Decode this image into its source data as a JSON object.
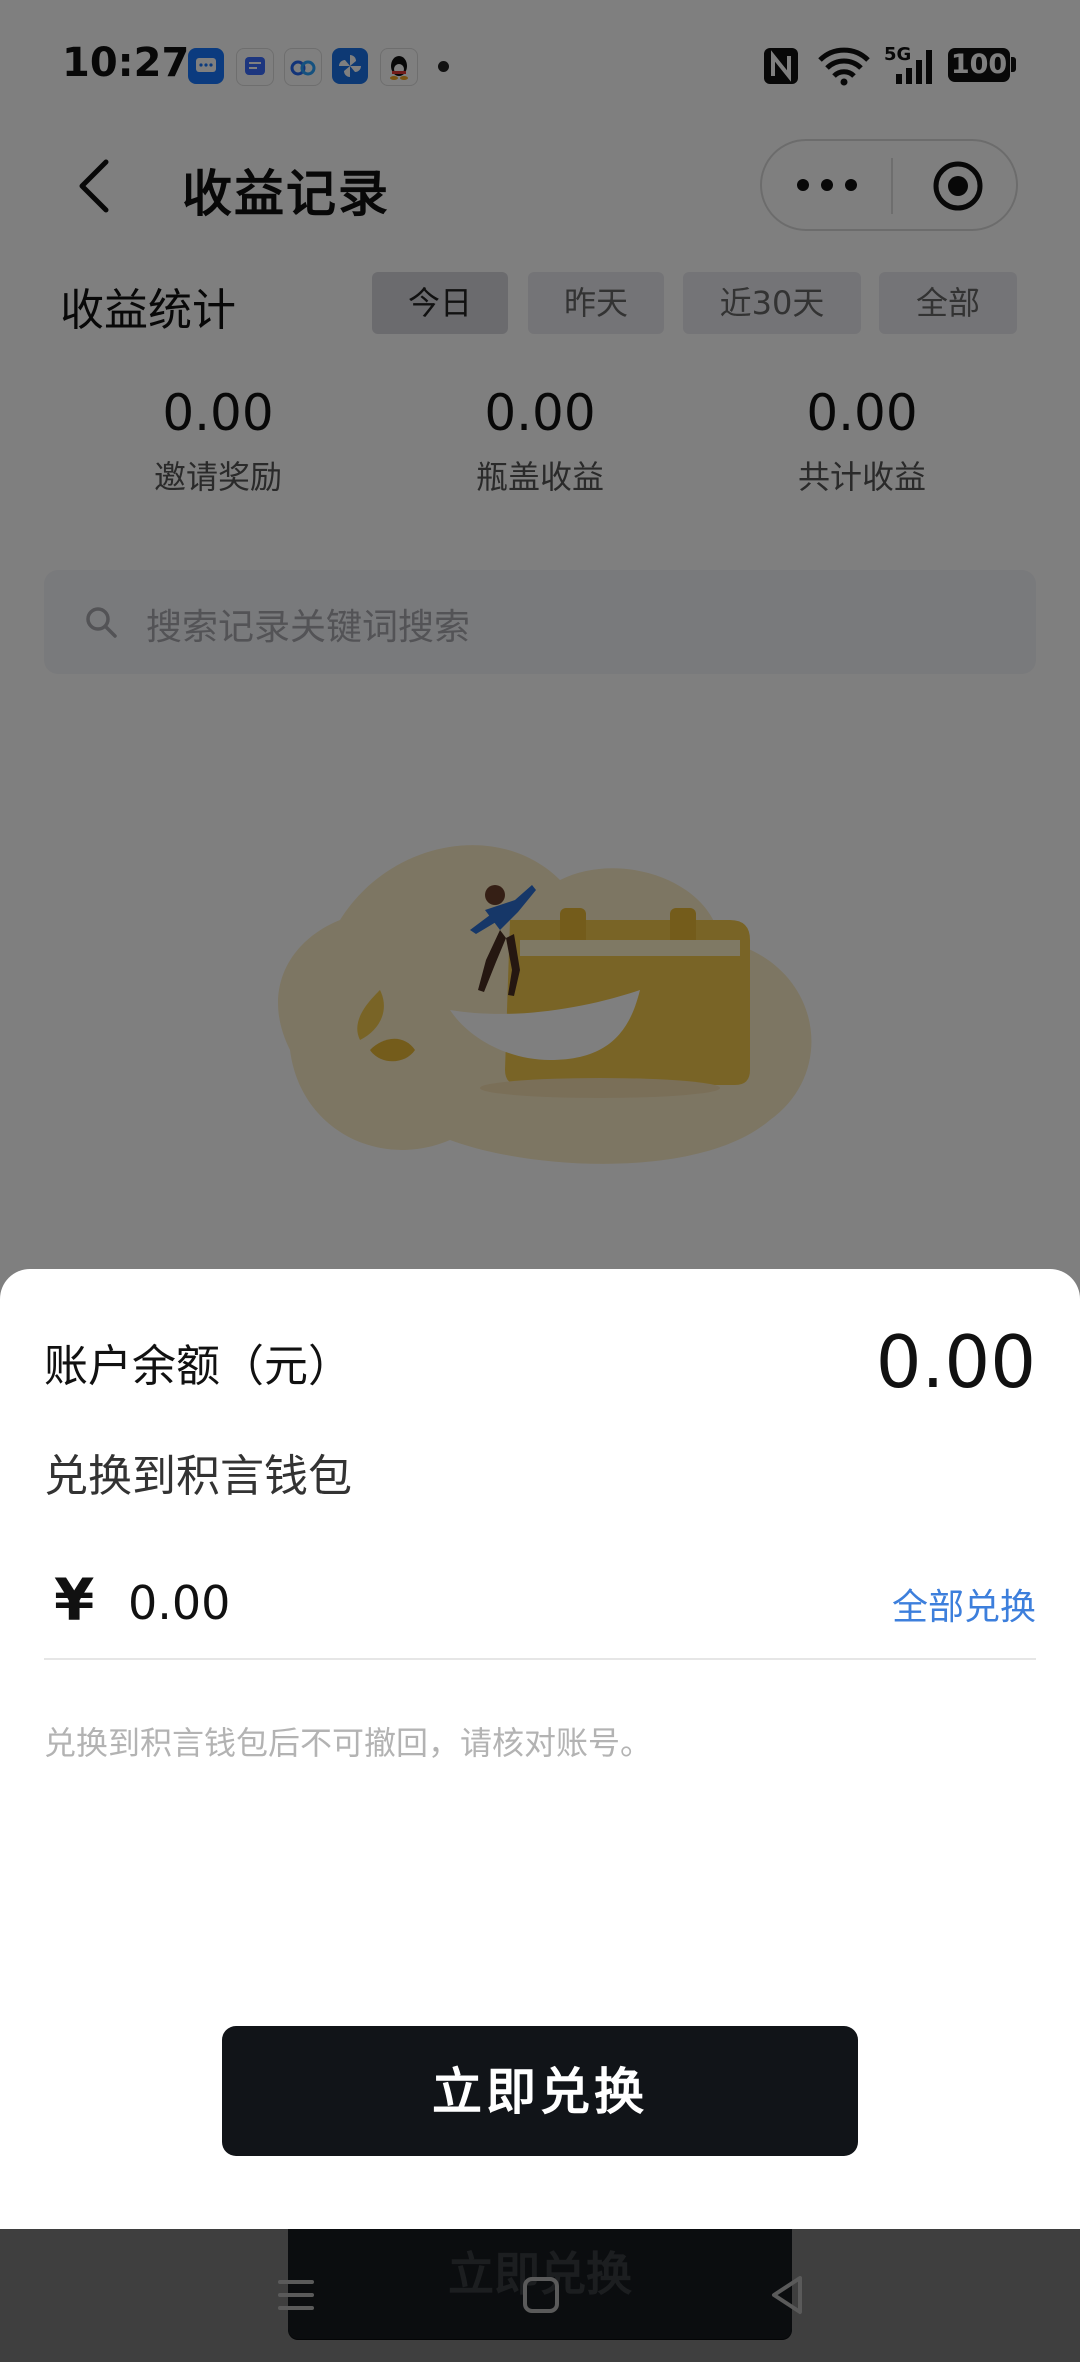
{
  "status_bar": {
    "time": "10:27",
    "network": "5G",
    "battery": "100",
    "app_icons": [
      "messages-icon",
      "chat-icon",
      "baidu-cloud-icon",
      "pinwheel-icon",
      "qq-icon"
    ]
  },
  "nav": {
    "title": "收益记录",
    "back_icon": "chevron-left-icon",
    "more_icon": "more-dots-icon",
    "close_icon": "target-icon"
  },
  "stats": {
    "title": "收益统计",
    "tabs": [
      "今日",
      "昨天",
      "近30天",
      "全部"
    ],
    "active_tab": "今日",
    "items": [
      {
        "value": "0.00",
        "label": "邀请奖励"
      },
      {
        "value": "0.00",
        "label": "瓶盖收益"
      },
      {
        "value": "0.00",
        "label": "共计收益"
      }
    ]
  },
  "search": {
    "placeholder": "搜索记录关键词搜索"
  },
  "background_button_label": "立即兑换",
  "sheet": {
    "balance_label": "账户余额（元）",
    "balance_value": "0.00",
    "exchange_title": "兑换到积言钱包",
    "currency_symbol": "¥",
    "amount_placeholder": "0.00",
    "exchange_all_label": "全部兑换",
    "hint": "兑换到积言钱包后不可撤回，请核对账号。",
    "confirm_label": "立即兑换"
  },
  "colors": {
    "link": "#3d7fdc",
    "button_bg": "#111418",
    "illustration_yellow": "#f2c94c"
  }
}
